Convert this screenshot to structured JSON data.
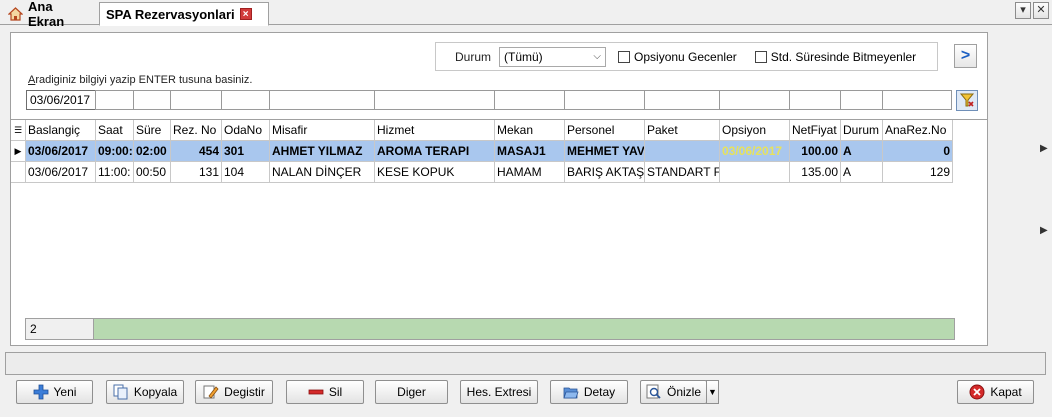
{
  "tabs": {
    "home_label": "Ana Ekran",
    "active_label": "SPA Rezervasyonlari",
    "close_glyph": "×"
  },
  "window": {
    "dropdown_glyph": "▾",
    "close_glyph": "✕"
  },
  "filters": {
    "status_label": "Durum",
    "status_value": "(Tümü)",
    "option1_label": "Opsiyonu Gecenler",
    "option2_label": "Std. Süresinde Bitmeyenler",
    "go_glyph": ">"
  },
  "search": {
    "hint_first_letter": "A",
    "hint_rest": "radiginiz bilgiyi yazip ENTER tusuna basiniz.",
    "date_value": "03/06/2017"
  },
  "grid": {
    "columns": [
      "Baslangiç",
      "Saat",
      "Süre",
      "Rez. No",
      "OdaNo",
      "Misafir",
      "Hizmet",
      "Mekan",
      "Personel",
      "Paket",
      "Opsiyon",
      "NetFiyat",
      "Durum",
      "AnaRez.No"
    ],
    "rows": [
      [
        "03/06/2017",
        "09:00:",
        "02:00",
        "454",
        "301",
        "AHMET YILMAZ",
        "AROMA TERAPI",
        "MASAJ1",
        "MEHMET YAV",
        "",
        "03/06/2017",
        "100.00",
        "A",
        "0"
      ],
      [
        "03/06/2017",
        "11:00:",
        "00:50",
        "131",
        "104",
        "NALAN DİNÇER",
        "KESE KOPUK",
        "HAMAM",
        "BARIŞ AKTAŞ",
        "STANDART F",
        "",
        "135.00",
        "A",
        "129"
      ]
    ],
    "record_count": "2"
  },
  "buttons": {
    "new": "Yeni",
    "copy": "Kopyala",
    "edit": "Degistir",
    "delete": "Sil",
    "other": "Diger",
    "account": "Hes. Extresi",
    "detail": "Detay",
    "preview": "Önizle",
    "close": "Kapat"
  },
  "colors": {
    "selected_row": "#a9c7ee",
    "footer_green": "#b7d9b0",
    "accent_blue": "#1b5fc2",
    "close_red": "#d23b3b"
  }
}
